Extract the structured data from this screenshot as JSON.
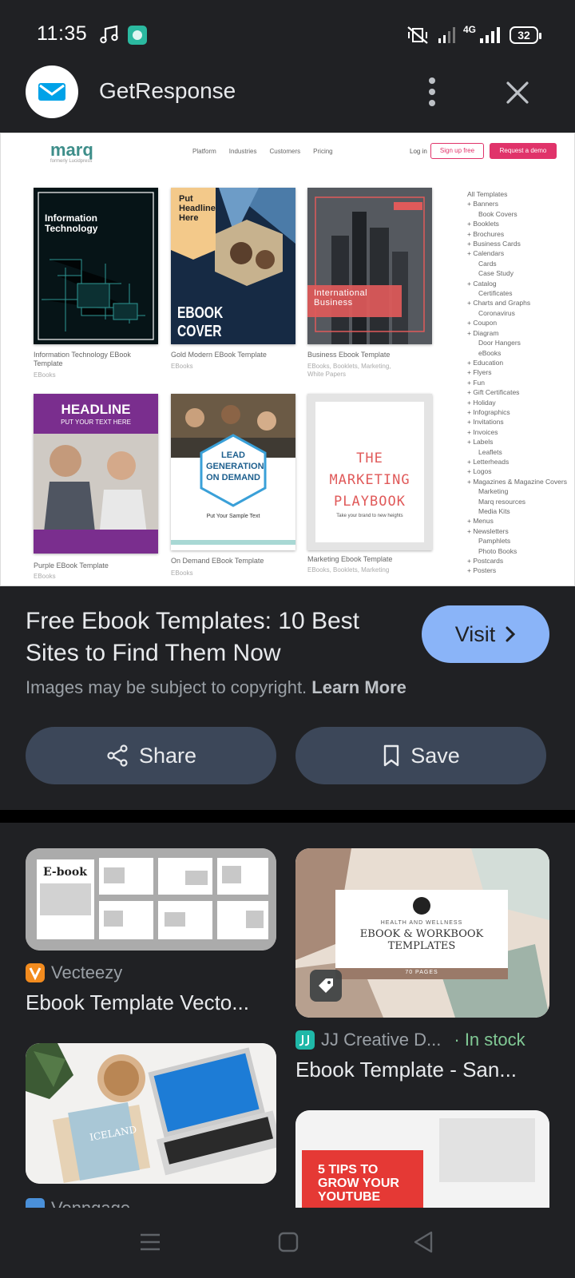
{
  "status_bar": {
    "time": "11:35",
    "network": "4G",
    "battery": "32"
  },
  "header": {
    "site_name": "GetResponse"
  },
  "preview": {
    "brand": "marq",
    "tagline": "formerly Lucidpress",
    "nav": [
      "Platform",
      "Industries",
      "Customers",
      "Pricing"
    ],
    "login": "Log in",
    "signup": "Sign up free",
    "demo": "Request a demo",
    "templates": [
      {
        "name": "Information Technology EBook Template",
        "category": "EBooks",
        "cover_title": "Information Technology"
      },
      {
        "name": "Gold Modern EBook Template",
        "category": "EBooks",
        "cover_title": "EBOOK COVER",
        "cover_sub": "Put Headline Here"
      },
      {
        "name": "Business Ebook Template",
        "category": "EBooks, Booklets, Marketing, White Papers",
        "cover_title": "International Business"
      },
      {
        "name": "Purple EBook Template",
        "category": "EBooks",
        "cover_title": "HEADLINE",
        "cover_sub": "PUT YOUR TEXT HERE"
      },
      {
        "name": "On Demand EBook Template",
        "category": "EBooks",
        "cover_title": "LEAD GENERATION ON DEMAND",
        "cover_sub": "Put Your Sample Text"
      },
      {
        "name": "Marketing Ebook Template",
        "category": "EBooks, Booklets, Marketing",
        "cover_title": "THE MARKETING PLAYBOOK",
        "cover_sub": "Take your brand to new heights"
      }
    ],
    "sidebar": [
      "All Templates",
      "+ Banners",
      "Book Covers",
      "+ Booklets",
      "+ Brochures",
      "+ Business Cards",
      "+ Calendars",
      "Cards",
      "Case Study",
      "+ Catalog",
      "Certificates",
      "+ Charts and Graphs",
      "Coronavirus",
      "+ Coupon",
      "+ Diagram",
      "Door Hangers",
      "eBooks",
      "+ Education",
      "+ Flyers",
      "+ Fun",
      "+ Gift Certificates",
      "+ Holiday",
      "+ Infographics",
      "+ Invitations",
      "+ Invoices",
      "+ Labels",
      "Leaflets",
      "+ Letterheads",
      "+ Logos",
      "+ Magazines & Magazine Covers",
      "Marketing",
      "Marq resources",
      "Media Kits",
      "+ Menus",
      "+ Newsletters",
      "Pamphlets",
      "Photo Books",
      "+ Postcards",
      "+ Posters"
    ]
  },
  "result": {
    "title": "Free Ebook Templates: 10 Best Sites to Find Them Now",
    "visit_label": "Visit",
    "copyright_text": "Images may be subject to copyright.",
    "learn_more": "Learn More",
    "share_label": "Share",
    "save_label": "Save"
  },
  "related": [
    {
      "source": "Vecteezy",
      "title": "Ebook Template Vecto...",
      "image_text": "E-book"
    },
    {
      "source": "JJ Creative D...",
      "stock": "· In stock",
      "title": "Ebook Template - San...",
      "image_text": "EBOOK & WORKBOOK TEMPLATES",
      "image_sub": "HEALTH AND WELLNESS",
      "image_pages": "70 PAGES"
    },
    {
      "source": "Venngage",
      "image_text": "ICELAND"
    },
    {
      "image_text": "5 TIPS TO GROW YOUR YOUTUBE"
    }
  ],
  "colors": {
    "accent": "#8ab4f8",
    "pill": "#3c4759",
    "background": "#202124",
    "in_stock": "#81c995",
    "marq_pink": "#e0336a"
  }
}
